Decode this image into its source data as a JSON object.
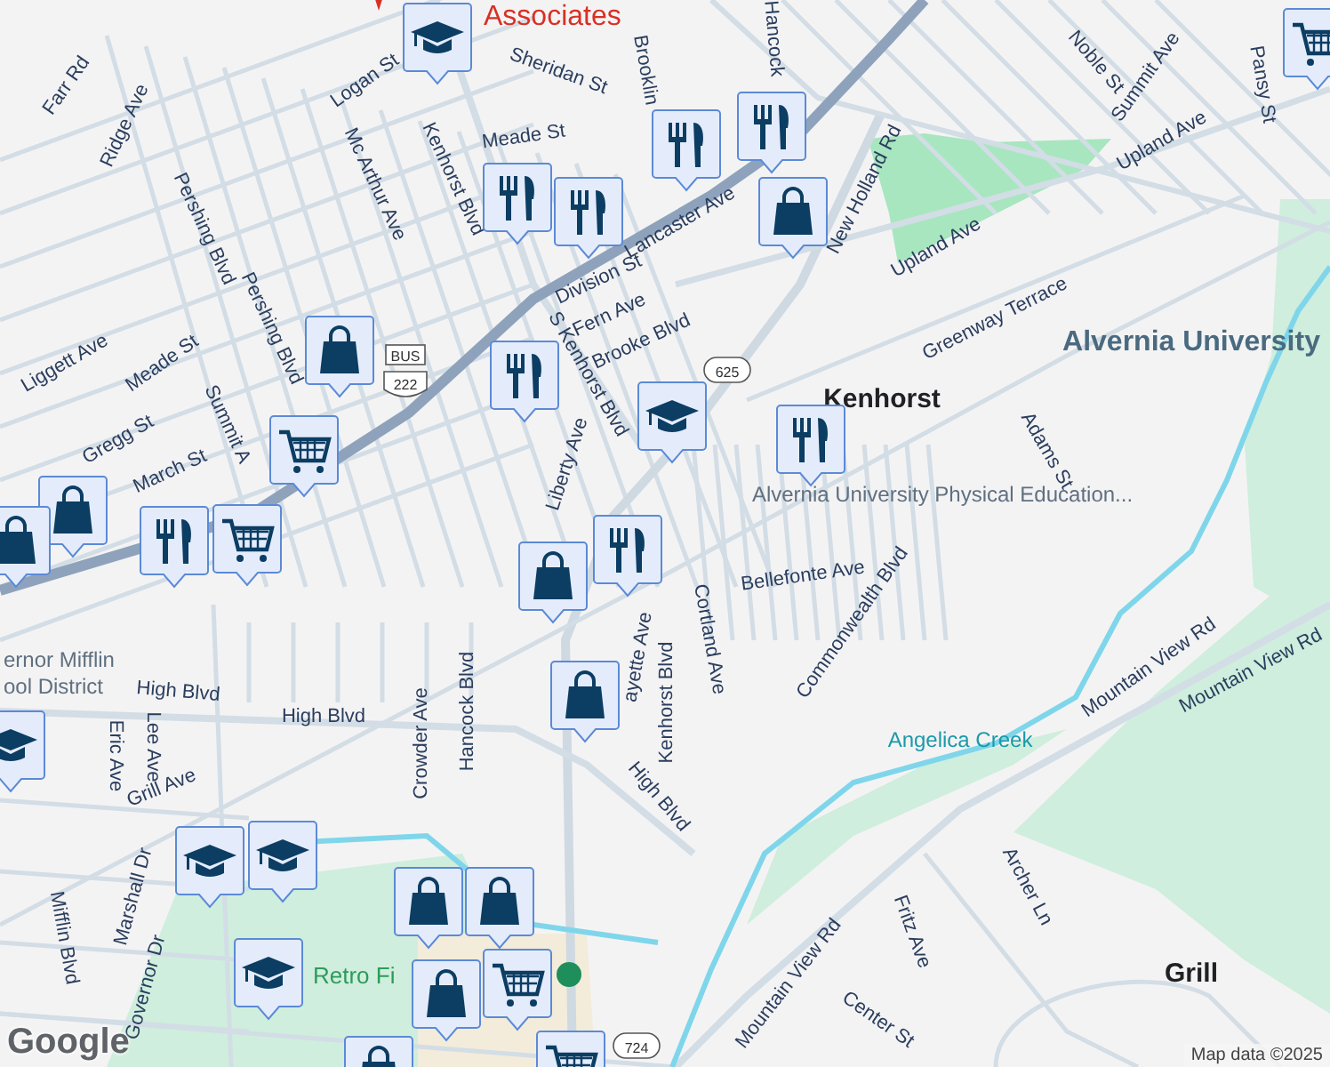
{
  "map": {
    "streets": [
      "Farr Rd",
      "Ridge Ave",
      "Logan St",
      "Mc Arthur Ave",
      "Sheridan St",
      "Meade St",
      "Kenhorst Blvd",
      "Pershing Blvd",
      "Lancaster Ave",
      "Division St",
      "Fern Ave",
      "Brooke Blvd",
      "S Kenhorst Blvd",
      "Liggett Ave",
      "Meade St",
      "Summit A",
      "Pershing Blvd",
      "Gregg St",
      "March St",
      "Liberty Ave",
      "Brooklin",
      "Hancock",
      "New Holland Rd",
      "Upland Ave",
      "Upland Ave",
      "Noble St",
      "Summit Ave",
      "Pansy St",
      "Greenway Terrace",
      "Adams St",
      "Bellefonte Ave",
      "Commonwealth Blvd",
      "Cortland Ave",
      "Kenhorst Blvd",
      "ayette Ave",
      "Mountain View Rd",
      "Mountain View Rd",
      "Mountain View Rd",
      "Archer Ln",
      "Fritz Ave",
      "Center St",
      "High Blvd",
      "High Blvd",
      "High Blvd",
      "Eric Ave",
      "Lee Ave",
      "Grill Ave",
      "Marshall Dr",
      "Governor Dr",
      "Mifflin Blvd",
      "Crowder Ave",
      "Hancock Blvd"
    ],
    "places": [
      {
        "name": "Associates",
        "kind": "business"
      },
      {
        "name": "Kenhorst",
        "kind": "town"
      },
      {
        "name": "Alvernia University",
        "kind": "university"
      },
      {
        "name": "Alvernia University Physical Education...",
        "kind": "poi"
      },
      {
        "name": "Angelica Creek",
        "kind": "water"
      },
      {
        "name": "Grill",
        "kind": "town"
      },
      {
        "name": "ernor Mifflin",
        "kind": "district"
      },
      {
        "name": "ool District",
        "kind": "district"
      },
      {
        "name": "Retro Fi",
        "kind": "park"
      }
    ],
    "shields": [
      {
        "label": "BUS",
        "kind": "banner"
      },
      {
        "label": "222",
        "kind": "us"
      },
      {
        "label": "625",
        "kind": "state"
      },
      {
        "label": "724",
        "kind": "state"
      }
    ],
    "pins": [
      {
        "kind": "school"
      },
      {
        "kind": "restaurant"
      },
      {
        "kind": "restaurant"
      },
      {
        "kind": "restaurant"
      },
      {
        "kind": "restaurant"
      },
      {
        "kind": "shopping"
      },
      {
        "kind": "shopping"
      },
      {
        "kind": "restaurant"
      },
      {
        "kind": "school"
      },
      {
        "kind": "restaurant"
      },
      {
        "kind": "grocery"
      },
      {
        "kind": "grocery"
      },
      {
        "kind": "shopping"
      },
      {
        "kind": "shopping"
      },
      {
        "kind": "restaurant"
      },
      {
        "kind": "restaurant"
      },
      {
        "kind": "shopping"
      },
      {
        "kind": "shopping"
      },
      {
        "kind": "school"
      },
      {
        "kind": "school"
      },
      {
        "kind": "school"
      },
      {
        "kind": "school"
      },
      {
        "kind": "shopping"
      },
      {
        "kind": "shopping"
      },
      {
        "kind": "grocery"
      },
      {
        "kind": "shopping"
      },
      {
        "kind": "shopping"
      },
      {
        "kind": "grocery"
      },
      {
        "kind": "grocery"
      }
    ],
    "attribution": "Map data ©2025",
    "logo": "Google"
  }
}
